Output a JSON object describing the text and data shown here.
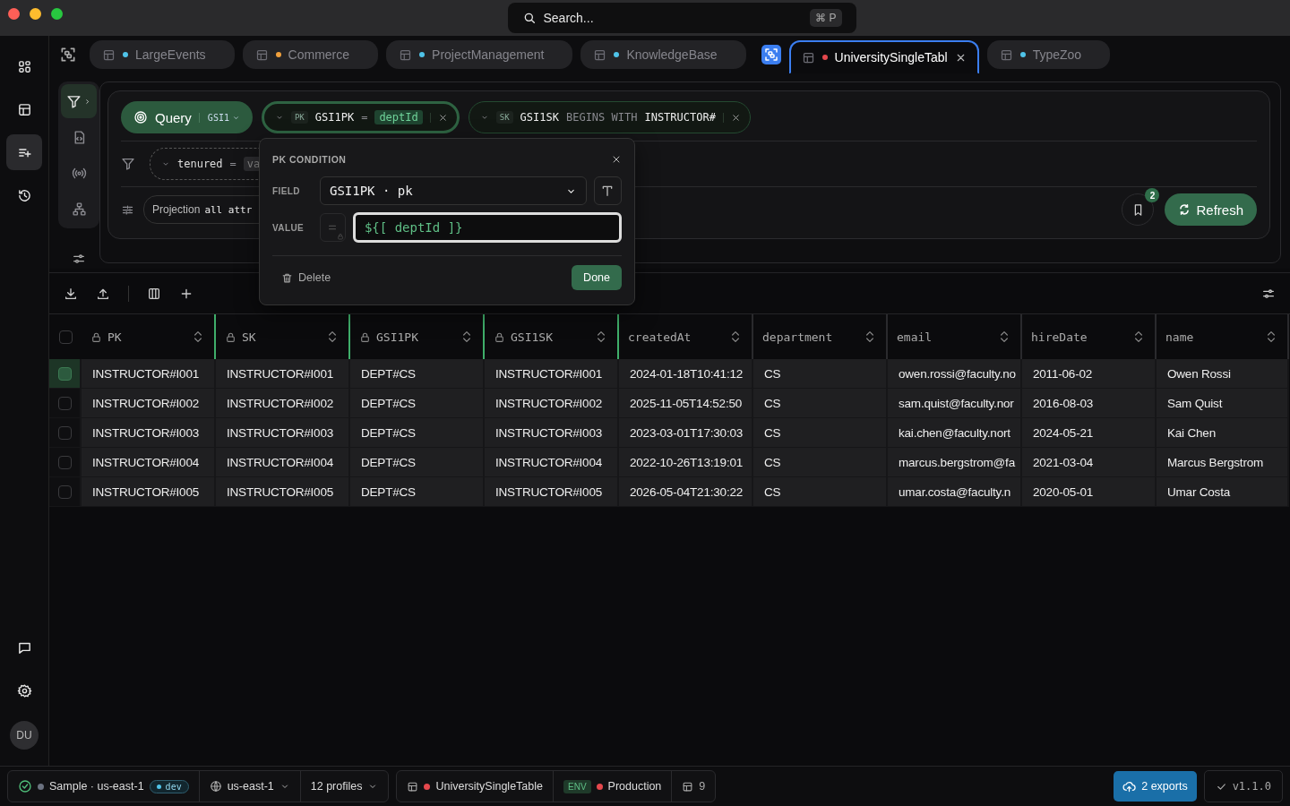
{
  "search": {
    "placeholder": "Search...",
    "shortcut": "⌘ P"
  },
  "sidebar": {
    "items": [
      {
        "kind": "grid",
        "selected": false
      },
      {
        "kind": "table",
        "selected": false
      },
      {
        "kind": "filter-add",
        "selected": true
      },
      {
        "kind": "history",
        "selected": false
      }
    ],
    "bottom_items": [
      {
        "kind": "chat"
      },
      {
        "kind": "settings"
      }
    ],
    "avatar": "DU"
  },
  "tabs": [
    {
      "label": "LargeEvents",
      "color": "#4fc3e8",
      "selected": false
    },
    {
      "label": "Commerce",
      "color": "#f0a03c",
      "selected": false
    },
    {
      "label": "ProjectManagement",
      "color": "#4fc3e8",
      "selected": false
    },
    {
      "label": "KnowledgeBase",
      "color": "#4fc3e8",
      "selected": false
    },
    {
      "label": "UniversitySingleTabl",
      "color": "#e5484d",
      "selected": true
    },
    {
      "label": "TypeZoo",
      "color": "#4fc3e8",
      "selected": false
    }
  ],
  "tool_rail": {
    "items": [
      {
        "kind": "filter",
        "selected": true
      },
      {
        "kind": "code-file",
        "selected": false
      },
      {
        "kind": "broadcast",
        "selected": false
      },
      {
        "kind": "hierarchy",
        "selected": false
      }
    ]
  },
  "query": {
    "mode": "Query",
    "index": "GSI1",
    "conditions": [
      {
        "tag": "PK",
        "field": "GSI1PK",
        "operator": "=",
        "value": "deptId",
        "kind": "variable",
        "active": true
      },
      {
        "tag": "SK",
        "field": "GSI1SK",
        "operator": "BEGINS WITH",
        "value": "INSTRUCTOR#",
        "kind": "literal",
        "active": false
      }
    ],
    "filter": {
      "field": "tenured",
      "operator": "=",
      "value": "va"
    },
    "projection": {
      "label": "Projection",
      "value": "all attr"
    },
    "saved_count": "2",
    "refresh": "Refresh"
  },
  "popover": {
    "title": "PK CONDITION",
    "field_label": "FIELD",
    "field_value": "GSI1PK · pk",
    "value_label": "VALUE",
    "value": "${[ deptId ]}",
    "delete": "Delete",
    "done": "Done"
  },
  "table": {
    "all_selected": false,
    "columns": [
      {
        "name": "PK",
        "key": true
      },
      {
        "name": "SK",
        "key": true
      },
      {
        "name": "GSI1PK",
        "key": true
      },
      {
        "name": "GSI1SK",
        "key": true
      },
      {
        "name": "createdAt",
        "key": false
      },
      {
        "name": "department",
        "key": false
      },
      {
        "name": "email",
        "key": false
      },
      {
        "name": "hireDate",
        "key": false
      },
      {
        "name": "name",
        "key": false
      }
    ],
    "rows": [
      {
        "selected": true,
        "cells": [
          "INSTRUCTOR#I001",
          "INSTRUCTOR#I001",
          "DEPT#CS",
          "INSTRUCTOR#I001",
          "2024-01-18T10:41:12",
          "CS",
          "owen.rossi@faculty.no",
          "2011-06-02",
          "Owen Rossi"
        ]
      },
      {
        "selected": false,
        "cells": [
          "INSTRUCTOR#I002",
          "INSTRUCTOR#I002",
          "DEPT#CS",
          "INSTRUCTOR#I002",
          "2025-11-05T14:52:50",
          "CS",
          "sam.quist@faculty.nor",
          "2016-08-03",
          "Sam Quist"
        ]
      },
      {
        "selected": false,
        "cells": [
          "INSTRUCTOR#I003",
          "INSTRUCTOR#I003",
          "DEPT#CS",
          "INSTRUCTOR#I003",
          "2023-03-01T17:30:03",
          "CS",
          "kai.chen@faculty.nort",
          "2024-05-21",
          "Kai Chen"
        ]
      },
      {
        "selected": false,
        "cells": [
          "INSTRUCTOR#I004",
          "INSTRUCTOR#I004",
          "DEPT#CS",
          "INSTRUCTOR#I004",
          "2022-10-26T13:19:01",
          "CS",
          "marcus.bergstrom@fa",
          "2021-03-04",
          "Marcus Bergstrom"
        ]
      },
      {
        "selected": false,
        "cells": [
          "INSTRUCTOR#I005",
          "INSTRUCTOR#I005",
          "DEPT#CS",
          "INSTRUCTOR#I005",
          "2026-05-04T21:30:22",
          "CS",
          "umar.costa@faculty.n",
          "2020-05-01",
          "Umar Costa"
        ]
      }
    ]
  },
  "status_bar": {
    "connection": {
      "label": "Sample · us-east-1",
      "color": "#6b7280"
    },
    "env_badge": {
      "label": "dev",
      "color": "#4fc3e8"
    },
    "region": "us-east-1",
    "profiles": "12 profiles",
    "table": {
      "label": "UniversitySingleTable",
      "color": "#e5484d"
    },
    "env": {
      "tag": "ENV",
      "label": "Production",
      "color": "#e5484d"
    },
    "table_count": "9",
    "exports": "2 exports",
    "version": "v1.1.0"
  }
}
